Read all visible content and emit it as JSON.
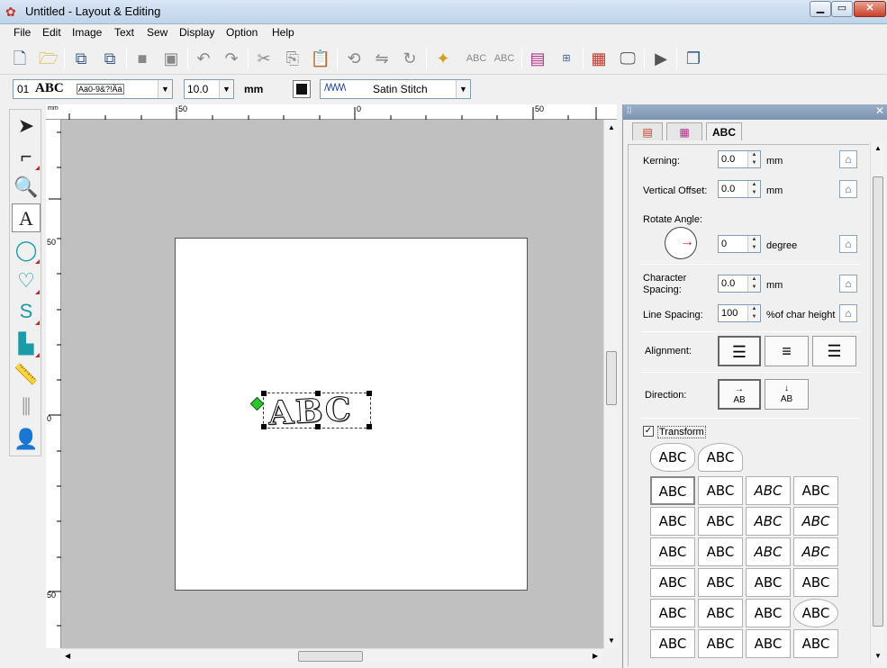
{
  "window": {
    "title": "Untitled - Layout & Editing"
  },
  "menu": [
    "File",
    "Edit",
    "Image",
    "Text",
    "Sew",
    "Display",
    "Option",
    "Help"
  ],
  "toolbar": {
    "icons": [
      "new-icon",
      "open-icon",
      "import-icon",
      "export-icon",
      "save-icon",
      "save-as-icon",
      "undo-icon",
      "redo-icon",
      "cut-icon",
      "copy-icon",
      "paste-icon",
      "rotate-left-icon",
      "flip-icon",
      "rotate-icon",
      "wizard-icon",
      "text-edit-icon",
      "abc-icon",
      "hoop-icon",
      "stitch-123-icon",
      "embroidery-icon",
      "monitor-icon",
      "stitch-sim-icon",
      "window-icon"
    ]
  },
  "propbar": {
    "font_num": "01",
    "font_sample": "ABC",
    "font_chars": "Aä0-9&?!Ää",
    "size_value": "10.0",
    "unit": "mm",
    "stitch": "Satin Stitch"
  },
  "tools": [
    "select-tool-icon",
    "point-edit-tool-icon",
    "zoom-tool-icon",
    "text-tool-icon",
    "shape-tool-icon",
    "heart-star-tool-icon",
    "curve-tool-icon",
    "stamp-tool-icon",
    "measure-tool-icon",
    "stitch-tool-icon",
    "figure-tool-icon"
  ],
  "ruler": {
    "unit": "mm",
    "top_labels": [
      "50",
      "0",
      "50"
    ],
    "left_labels": [
      "50",
      "0",
      "50"
    ]
  },
  "canvas": {
    "text": "ABC"
  },
  "panel": {
    "tabs": [
      "",
      "",
      "ABC"
    ],
    "kerning_label": "Kerning:",
    "kerning_value": "0.0",
    "kerning_unit": "mm",
    "voffset_label": "Vertical Offset:",
    "voffset_value": "0.0",
    "voffset_unit": "mm",
    "rotate_label": "Rotate Angle:",
    "rotate_value": "0",
    "rotate_unit": "degree",
    "charspacing_label": "Character Spacing:",
    "charspacing_value": "0.0",
    "charspacing_unit": "mm",
    "linespacing_label": "Line Spacing:",
    "linespacing_value": "100",
    "linespacing_unit": "%of char height",
    "alignment_label": "Alignment:",
    "direction_label": "Direction:",
    "direction_h": "AB",
    "direction_v": "AB",
    "transform_label": "Transform",
    "transform_checked": true,
    "transform_sample": "ABC"
  }
}
